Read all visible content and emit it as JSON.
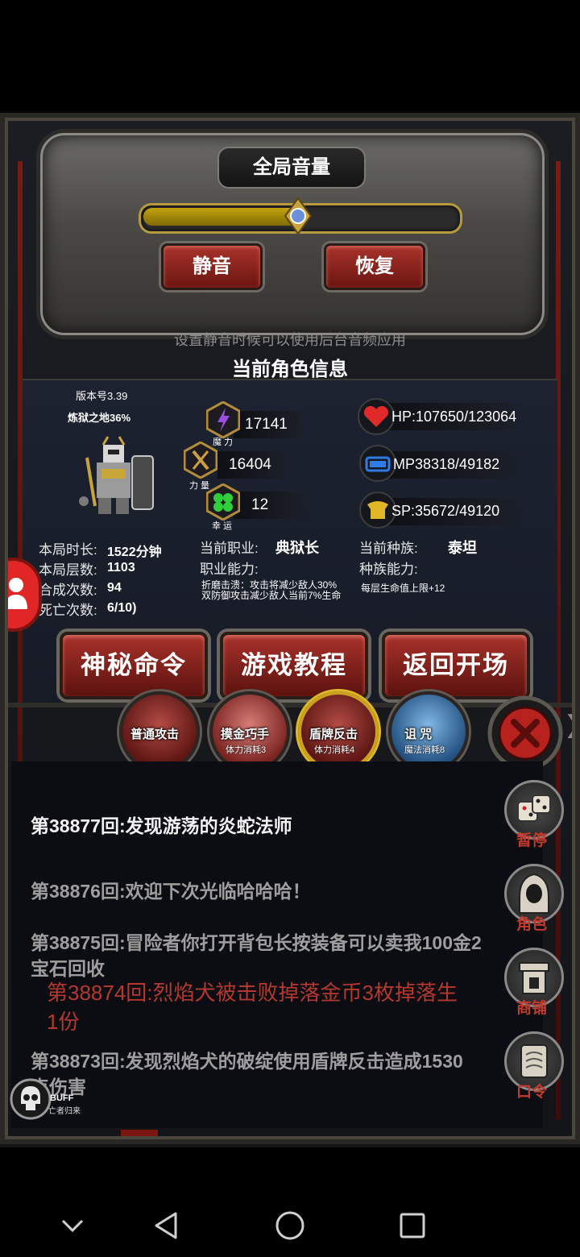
{
  "volume": {
    "title": "全局音量",
    "level": 0.5,
    "mute_label": "静音",
    "restore_label": "恢复",
    "hint": "设置静音时候可以使用后台音频应用"
  },
  "character": {
    "section_title": "当前角色信息",
    "version": "版本号3.39",
    "area_progress": "炼狱之地36%",
    "stats": {
      "magic": {
        "value": "17141",
        "caption": "魔 力"
      },
      "strength": {
        "value": "16404",
        "caption": "力 量"
      },
      "luck": {
        "value": "12",
        "caption": "幸 运"
      }
    },
    "hp": "HP:107650/123064",
    "mp": "MP38318/49182",
    "sp": "SP:35672/49120",
    "info": {
      "duration_label": "本局时长:",
      "duration_value": "1522分钟",
      "floors_label": "本局层数:",
      "floors_value": "1103",
      "craft_label": "合成次数:",
      "craft_value": "94",
      "death_label": "死亡次数:",
      "death_value": "6/10)",
      "job_label": "当前职业:",
      "job_value": "典狱长",
      "job_skill_label": "职业能力:",
      "job_skill_desc": "折磨击溃：攻击将减少敌人30%双防御攻击减少敌人当前7%生命",
      "race_label": "当前种族:",
      "race_value": "泰坦",
      "race_skill_label": "种族能力:",
      "race_skill_desc": "每层生命值上限+12"
    },
    "buttons": {
      "mystery": "神秘命令",
      "tutorial": "游戏教程",
      "back": "返回开场"
    }
  },
  "skills": [
    {
      "name": "普通攻击",
      "cost": ""
    },
    {
      "name": "摸金巧手",
      "cost": "体力消耗3"
    },
    {
      "name": "盾牌反击",
      "cost": "体力消耗4"
    },
    {
      "name": "诅 咒",
      "cost": "魔法消耗8"
    }
  ],
  "log": [
    "第38877回:发现游荡的炎蛇法师",
    "第38876回:欢迎下次光临哈哈哈！",
    "第38875回:冒险者你打开背包长按装备可以卖我100金2",
    "宝石回收",
    "第38874回:烈焰犬被击败掉落金币3枚掉落生",
    "1份",
    "第38873回:发现烈焰犬的破绽使用盾牌反击造成1530",
    "点伤害"
  ],
  "side_buttons": {
    "pause": "暂停",
    "role": "角色",
    "shop": "商铺",
    "command": "口令"
  },
  "buff": {
    "label": "BUFF",
    "sub": "亡者归来"
  }
}
